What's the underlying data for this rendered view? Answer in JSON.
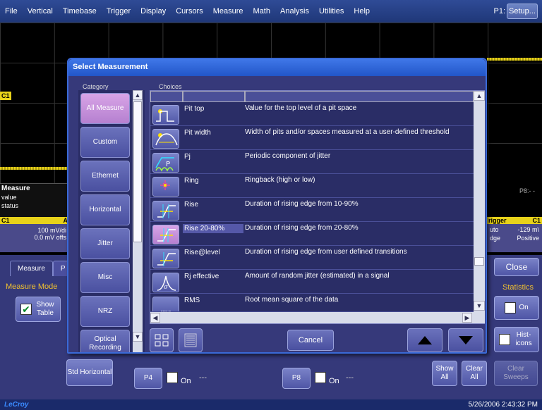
{
  "menu": {
    "items": [
      "File",
      "Vertical",
      "Timebase",
      "Trigger",
      "Display",
      "Cursors",
      "Measure",
      "Math",
      "Analysis",
      "Utilities",
      "Help"
    ],
    "p1_label": "P1:",
    "setup_label": "Setup..."
  },
  "scope": {
    "c1_tag": "C1",
    "p8_label": "P8:- -",
    "left_info": {
      "header": "Measure",
      "row1": "value",
      "row2": "status"
    },
    "c1_band": "C1",
    "c1_band_right": "A",
    "ch1": {
      "line1": "100 mV/di",
      "line2": "0.0 mV offs"
    },
    "trigger": {
      "band": "rigger",
      "band_right": "C1",
      "row1_left": "uto",
      "row1_right": "-129 m\\",
      "row2_left": "dge",
      "row2_right": "Positive"
    }
  },
  "dialog": {
    "title": "Select Measurement",
    "category_header": "Category",
    "choices_header": "Choices",
    "categories": [
      {
        "label": "All Measure",
        "selected": true
      },
      {
        "label": "Custom"
      },
      {
        "label": "Ethernet"
      },
      {
        "label": "Horizontal"
      },
      {
        "label": "Jitter"
      },
      {
        "label": "Misc"
      },
      {
        "label": "NRZ"
      },
      {
        "label": "Optical Recording"
      }
    ],
    "choices": [
      {
        "name": "Pit top",
        "desc": "Value for the top level of a pit space",
        "icon": "pit-top-icon"
      },
      {
        "name": "Pit width",
        "desc": "Width of pits and/or spaces measured at a user-defined threshold",
        "icon": "pit-width-icon"
      },
      {
        "name": "Pj",
        "desc": "Periodic component of jitter",
        "icon": "pj-icon"
      },
      {
        "name": "Ring",
        "desc": "Ringback (high or low)",
        "icon": "ring-icon"
      },
      {
        "name": "Rise",
        "desc": "Duration of rising edge from 10-90%",
        "icon": "rise-icon"
      },
      {
        "name": "Rise 20-80%",
        "desc": "Duration of rising edge from 20-80%",
        "icon": "rise-20-80-icon",
        "selected": true
      },
      {
        "name": "Rise@level",
        "desc": "Duration of rising edge from user defined transitions",
        "icon": "rise-at-level-icon"
      },
      {
        "name": "Rj effective",
        "desc": "Amount of random jitter (estimated) in a signal",
        "icon": "rj-effective-icon"
      },
      {
        "name": "RMS",
        "desc": "Root mean square of the data",
        "icon": "rms-icon"
      }
    ],
    "rms_icon_text": "rms",
    "cancel_label": "Cancel"
  },
  "bottom": {
    "tab_measure": "Measure",
    "tab_p": "P",
    "measure_mode": "Measure Mode",
    "show_table": "Show Table",
    "std_horizontal": "Std Horizontal",
    "p4": "P4",
    "p8": "P8",
    "on": "On",
    "dashes": "---",
    "close": "Close",
    "statistics": "Statistics",
    "stat_on": "On",
    "histicons": "Hist-icons",
    "show_all": "Show All",
    "clear_all": "Clear All",
    "clear_sweeps": "Clear Sweeps"
  },
  "status": {
    "logo": "LeCroy",
    "datetime": "5/26/2006 2:43:32 PM"
  },
  "colors": {
    "menubar": "#2f4b96",
    "dialog_bg": "#36397a",
    "title_bar": "#2256c8",
    "selected_pink": "#c890dc",
    "trace_yellow": "#e8d21a"
  }
}
